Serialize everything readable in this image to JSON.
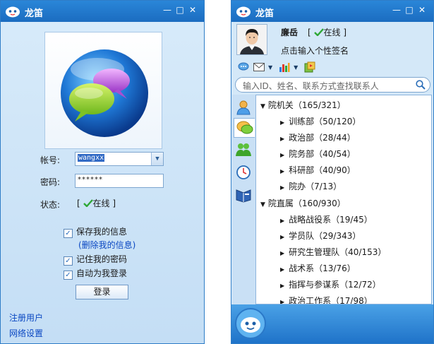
{
  "login": {
    "title": "龙笛",
    "account_label": "帐号:",
    "account_value": "wangxx",
    "password_label": "密码:",
    "password_value": "******",
    "status_label": "状态:",
    "status_value": "在线",
    "save_info": "保存我的信息",
    "delete_info": "(删除我的信息)",
    "remember_pwd": "记住我的密码",
    "auto_login": "自动为我登录",
    "login_button": "登录",
    "register": "注册用户",
    "network": "网络设置"
  },
  "main": {
    "title": "龙笛",
    "user_name": "廉岳",
    "status": "在线",
    "signature": "点击输入个性签名",
    "search_placeholder": "输入ID、姓名、联系方式查找联系人",
    "groups": [
      {
        "name": "院机关（165/321）",
        "children": [
          "训练部（50/120）",
          "政治部（28/44）",
          "院务部（40/54）",
          "科研部（40/90）",
          "院办（7/13）"
        ]
      },
      {
        "name": "院直属（160/930）",
        "children": [
          "战略战役系（19/45）",
          "学员队（29/343）",
          "研究生管理队（40/153）",
          "战术系（13/76）",
          "指挥与参谋系（12/72）",
          "政治工作系（17/98）"
        ]
      }
    ]
  },
  "colors": {
    "titlebar": "#1b6cc0",
    "link": "#0a47c2",
    "online_check": "#2ea836"
  }
}
